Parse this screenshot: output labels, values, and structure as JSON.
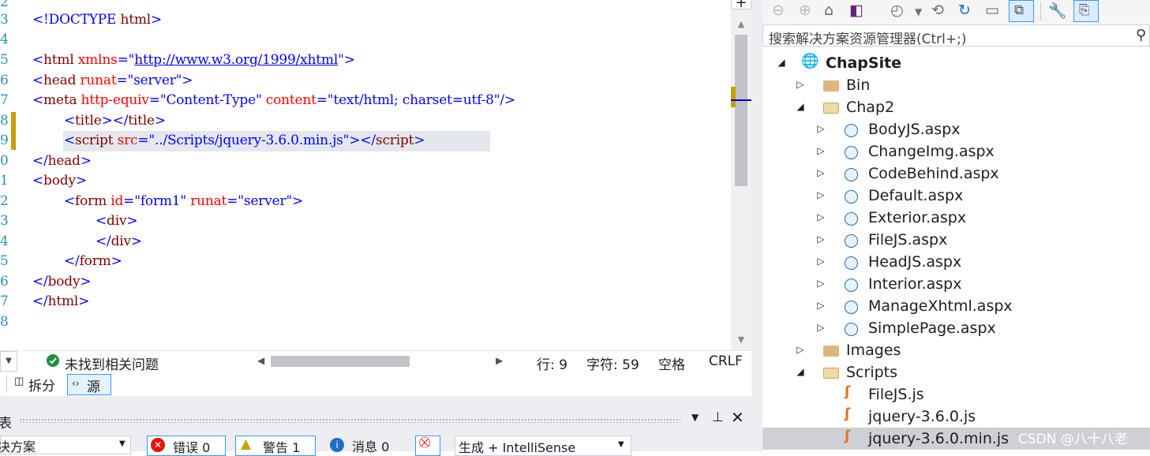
{
  "editor": {
    "line_numbers": [
      "2",
      "3",
      "4",
      "5",
      "6",
      "7",
      "8",
      "9",
      "0",
      "1",
      "2",
      "3",
      "4",
      "5",
      "6",
      "7",
      "8"
    ],
    "lines": [
      {
        "t1": "<!DOCTYPE ",
        "t2": "html",
        "t3": ">"
      },
      {},
      {
        "open": "<",
        "tag": "html",
        "attr": " xmlns",
        "eq": "=\"",
        "val": "http://www.w3.org/1999/xhtml",
        "close": "\">"
      },
      {
        "open": "<",
        "tag": "head",
        "attr": " runat",
        "eq": "=\"",
        "val": "server",
        "close": "\">"
      },
      {
        "open": "<",
        "tag": "meta",
        "attr": " http-equiv",
        "eq": "=\"",
        "val": "Content-Type",
        "q": "\"",
        "attr2": " content",
        "eq2": "=\"",
        "val2": "text/html; charset=utf-8",
        "close": "\"/>"
      },
      {
        "open": "<",
        "tag": "title",
        "mid": "></",
        "tag2": "title",
        "close": ">"
      },
      {
        "open": "<",
        "tag": "script",
        "attr": " src",
        "eq": "=\"",
        "val": "../Scripts/jquery-3.6.0.min.js",
        "mid": "\"></",
        "tag2": "script",
        "close": ">"
      },
      {
        "open": "</",
        "tag": "head",
        "close": ">"
      },
      {
        "open": "<",
        "tag": "body",
        "close": ">"
      },
      {
        "open": "<",
        "tag": "form",
        "attr": " id",
        "eq": "=\"",
        "val": "form1",
        "q": "\"",
        "attr2": " runat",
        "eq2": "=\"",
        "val2": "server",
        "close": "\">"
      },
      {
        "open": "<",
        "tag": "div",
        "close": ">"
      },
      {
        "open": "</",
        "tag": "div",
        "close": ">"
      },
      {
        "open": "</",
        "tag": "form",
        "close": ">"
      },
      {
        "open": "</",
        "tag": "body",
        "close": ">"
      },
      {
        "open": "</",
        "tag": "html",
        "close": ">"
      }
    ]
  },
  "status": {
    "issues": "未找到相关问题",
    "line": "行: 9",
    "char": "字符: 59",
    "space": "空格",
    "eol": "CRLF"
  },
  "viewbar": {
    "split": "拆分",
    "source": "源"
  },
  "errors_panel": {
    "title": "表",
    "scope": "决方案",
    "errors": "错误 0",
    "warnings": "警告 1",
    "messages": "消息 0",
    "build": "生成 + IntelliSense"
  },
  "solution_explorer": {
    "search_placeholder": "搜索解决方案资源管理器(Ctrl+;)",
    "project": "ChapSite",
    "items": [
      {
        "label": "Bin",
        "type": "folder"
      },
      {
        "label": "Chap2",
        "type": "folder-open"
      },
      {
        "label": "BodyJS.aspx",
        "type": "aspx"
      },
      {
        "label": "ChangeImg.aspx",
        "type": "aspx"
      },
      {
        "label": "CodeBehind.aspx",
        "type": "aspx"
      },
      {
        "label": "Default.aspx",
        "type": "aspx"
      },
      {
        "label": "Exterior.aspx",
        "type": "aspx"
      },
      {
        "label": "FileJS.aspx",
        "type": "aspx"
      },
      {
        "label": "HeadJS.aspx",
        "type": "aspx"
      },
      {
        "label": "Interior.aspx",
        "type": "aspx"
      },
      {
        "label": "ManageXhtml.aspx",
        "type": "aspx"
      },
      {
        "label": "SimplePage.aspx",
        "type": "aspx"
      },
      {
        "label": "Images",
        "type": "folder"
      },
      {
        "label": "Scripts",
        "type": "folder-open"
      },
      {
        "label": "FileJS.js",
        "type": "js"
      },
      {
        "label": "jquery-3.6.0.js",
        "type": "js"
      },
      {
        "label": "jquery-3.6.0.min.js",
        "type": "js"
      }
    ]
  },
  "watermark": "CSDN @八十八老",
  "colors": {
    "tag": "#800000",
    "attr": "#ff0000",
    "value": "#0000ff",
    "linenum": "#2b91af",
    "selection": "#cce8ff",
    "accent": "#3399ff"
  }
}
